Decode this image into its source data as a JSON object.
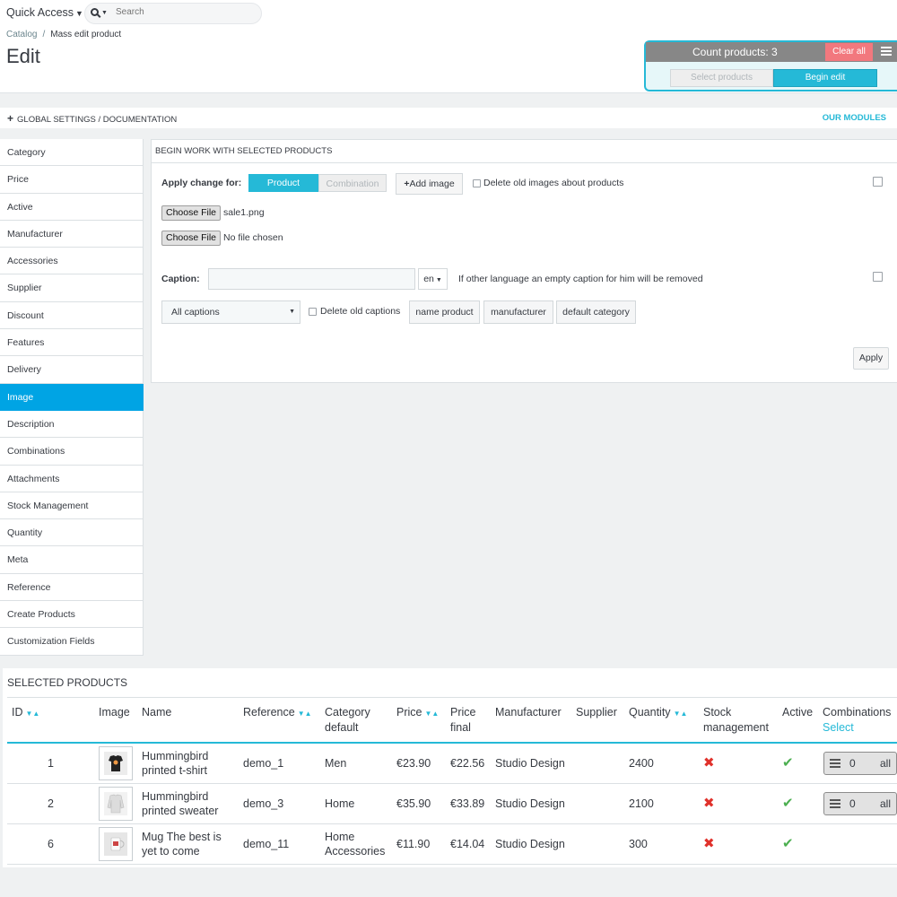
{
  "header": {
    "quick_access": "Quick Access",
    "search_placeholder": "Search",
    "breadcrumb": [
      "Catalog",
      "Mass edit product"
    ],
    "page_title": "Edit"
  },
  "count_panel": {
    "count_text": "Count products: 3",
    "clear_all": "Clear all",
    "select_products": "Select products",
    "begin_edit": "Begin edit"
  },
  "global_bar": {
    "left": "GLOBAL SETTINGS / DOCUMENTATION",
    "right": "OUR MODULES"
  },
  "sidebar": {
    "active": "Image",
    "items": [
      "Category",
      "Price",
      "Active",
      "Manufacturer",
      "Accessories",
      "Supplier",
      "Discount",
      "Features",
      "Delivery",
      "Image",
      "Description",
      "Combinations",
      "Attachments",
      "Stock Management",
      "Quantity",
      "Meta",
      "Reference",
      "Create Products",
      "Customization Fields"
    ]
  },
  "work": {
    "heading": "BEGIN WORK WITH SELECTED PRODUCTS",
    "apply_change_label": "Apply change for:",
    "toggle_product": "Product",
    "toggle_combination": "Combination",
    "add_image": "Add image",
    "delete_old_images": "Delete old images about products",
    "file1_btn": "Choose File",
    "file1_name": "sale1.png",
    "file2_btn": "Choose File",
    "file2_name": "No file chosen",
    "caption_label": "Caption:",
    "caption_value": "",
    "lang": "en",
    "lang_note": "If other language an empty caption for him will be removed",
    "captions_select": "All captions",
    "delete_old_captions": "Delete old captions",
    "tag_name_product": "name product",
    "tag_manufacturer": "manufacturer",
    "tag_default_category": "default category",
    "apply": "Apply"
  },
  "products": {
    "title": "SELECTED PRODUCTS",
    "columns": {
      "id": "ID",
      "image": "Image",
      "name": "Name",
      "reference": "Reference",
      "category": "Category default",
      "price": "Price",
      "price_final": "Price final",
      "manufacturer": "Manufacturer",
      "supplier": "Supplier",
      "quantity": "Quantity",
      "stock": "Stock management",
      "active": "Active",
      "combinations": "Combinations",
      "combinations_link": "Select"
    },
    "rows": [
      {
        "id": "1",
        "name": "Hummingbird printed t-shirt",
        "reference": "demo_1",
        "category": "Men",
        "price": "€23.90",
        "price_final": "€22.56",
        "manufacturer": "Studio Design",
        "supplier": "",
        "quantity": "2400",
        "stock_management": false,
        "active": true,
        "combinations_count": "0",
        "combinations_all": "all",
        "image_icon": "tshirt-thumbnail"
      },
      {
        "id": "2",
        "name": "Hummingbird printed sweater",
        "reference": "demo_3",
        "category": "Home",
        "price": "€35.90",
        "price_final": "€33.89",
        "manufacturer": "Studio Design",
        "supplier": "",
        "quantity": "2100",
        "stock_management": false,
        "active": true,
        "combinations_count": "0",
        "combinations_all": "all",
        "image_icon": "sweater-thumbnail"
      },
      {
        "id": "6",
        "name": "Mug The best is yet to come",
        "reference": "demo_11",
        "category": "Home Accessories",
        "price": "€11.90",
        "price_final": "€14.04",
        "manufacturer": "Studio Design",
        "supplier": "",
        "quantity": "300",
        "stock_management": false,
        "active": true,
        "image_icon": "mug-thumbnail"
      }
    ]
  },
  "colors": {
    "accent": "#25b9d7",
    "nav_active": "#00a4e4",
    "clear_all": "#f2787e",
    "cross": "#e0312b",
    "check": "#4caf50"
  }
}
